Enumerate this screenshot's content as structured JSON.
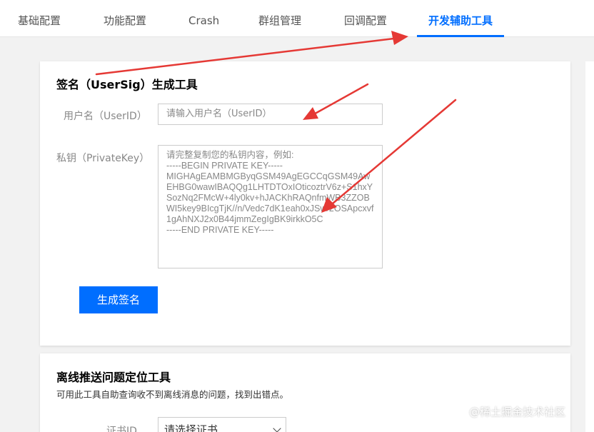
{
  "tabs": [
    {
      "label": "基础配置",
      "active": false
    },
    {
      "label": "功能配置",
      "active": false
    },
    {
      "label": "Crash",
      "active": false
    },
    {
      "label": "群组管理",
      "active": false
    },
    {
      "label": "回调配置",
      "active": false
    },
    {
      "label": "开发辅助工具",
      "active": true
    }
  ],
  "sig_tool": {
    "title": "签名（UserSig）生成工具",
    "userid_label": "用户名（UserID）",
    "userid_placeholder": "请输入用户名（UserID）",
    "key_label": "私钥（PrivateKey）",
    "key_placeholder": "请完整复制您的私钥内容，例如:\n-----BEGIN PRIVATE KEY-----\nMIGHAgEAMBMGByqGSM49AgEGCCqGSM49AwEHBG0wawIBAQQg1LHTDTOxIOticoztrV6z+S1hxYSozNq2FMcW+4ly0kv+hJACKhRAQnfmWB3ZZOBWI5key9BIcgTjK//n/Vedc7dK1eah0xJSw/2OSApcxvf1gAhNXJ2x0B44jmmZegIgBK9irkkO5C\n-----END PRIVATE KEY-----",
    "generate_button": "生成签名"
  },
  "offline_tool": {
    "title": "离线推送问题定位工具",
    "description": "可用此工具自助查询收不到离线消息的问题，找到出错点。",
    "cert_label": "证书ID",
    "cert_select_value": "请选择证书"
  },
  "watermark": "@稀土掘金技术社区",
  "colors": {
    "accent": "#006eff",
    "arrow": "#e53935",
    "background": "#f2f2f2"
  }
}
